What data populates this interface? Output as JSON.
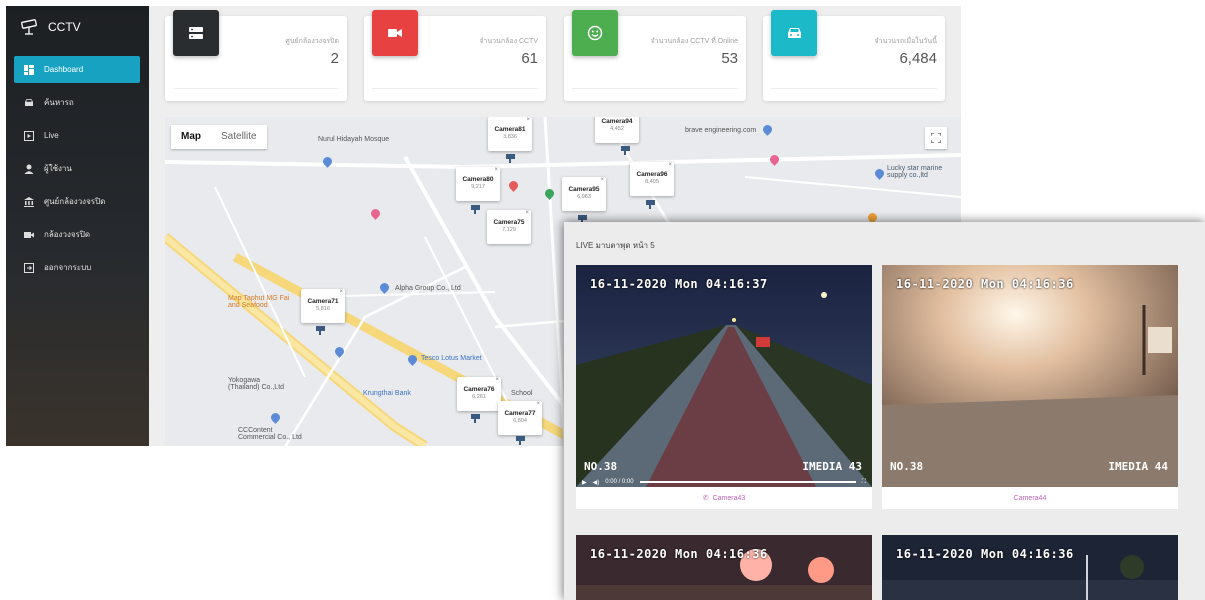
{
  "app": {
    "title": "CCTV"
  },
  "sidebar": {
    "items": [
      {
        "label": "Dashboard",
        "icon": "dashboard-icon"
      },
      {
        "label": "ค้นหารถ",
        "icon": "car-icon"
      },
      {
        "label": "Live",
        "icon": "live-icon"
      },
      {
        "label": "ผู้ใช้งาน",
        "icon": "user-icon"
      },
      {
        "label": "ศูนย์กล้องวงจรปิด",
        "icon": "building-icon"
      },
      {
        "label": "กล้องวงจรปิด",
        "icon": "camera-icon"
      },
      {
        "label": "ออกจากระบบ",
        "icon": "logout-icon"
      }
    ]
  },
  "stats": [
    {
      "label": "ศูนย์กล้องวงจรปิด",
      "value": "2",
      "color": "#2a2d30",
      "icon": "server-icon"
    },
    {
      "label": "จำนวนกล้อง CCTV",
      "value": "61",
      "color": "#e84141",
      "icon": "video-camera-icon"
    },
    {
      "label": "จำนวนกล้อง CCTV ที่ Online",
      "value": "53",
      "color": "#4cae4f",
      "icon": "smile-icon"
    },
    {
      "label": "จำนวนรถเมื่อในวันนี้",
      "value": "6,484",
      "color": "#1cb9c8",
      "icon": "car-icon"
    }
  ],
  "map": {
    "tab_map": "Map",
    "tab_satellite": "Satellite",
    "labels": [
      "Nurul Hidayah Mosque",
      "brave engineering.com",
      "Lucky star marine supply co.,ltd",
      "Alpha Group Co., Ltd",
      "Map Taphut MG Fai and Seafood",
      "Tesco Lotus Market",
      "Yokogawa (Thailand) Co.,Ltd",
      "Krungthai Bank",
      "CCContent Commercial Co., Ltd",
      "School"
    ],
    "cameras": [
      {
        "name": "Camera81",
        "value": "3,836"
      },
      {
        "name": "Camera94",
        "value": "4,452"
      },
      {
        "name": "Camera80",
        "value": "9,217"
      },
      {
        "name": "Camera96",
        "value": "8,405"
      },
      {
        "name": "Camera95",
        "value": "6,963"
      },
      {
        "name": "Camera75",
        "value": "7,129"
      },
      {
        "name": "Camera71",
        "value": "5,816"
      },
      {
        "name": "Camera76",
        "value": "6,261"
      },
      {
        "name": "Camera77",
        "value": "6,804"
      }
    ]
  },
  "live": {
    "title": "LIVE มาบตาพุด หน้า 5",
    "videos": [
      {
        "timestamp": "16-11-2020 Mon 04:16:37",
        "no": "NO.38",
        "brand": "IMEDIA 43",
        "caption": "Camera43",
        "time_display": "0:00 / 0:00"
      },
      {
        "timestamp": "16-11-2020 Mon 04:16:36",
        "no": "NO.38",
        "brand": "IMEDIA 44",
        "caption": "Camera44"
      },
      {
        "timestamp": "16-11-2020 Mon 04:16:36"
      },
      {
        "timestamp": "16-11-2020 Mon 04:16:36"
      }
    ]
  },
  "colors": {
    "accent": "#17a2c2",
    "caption": "#c063b8"
  }
}
